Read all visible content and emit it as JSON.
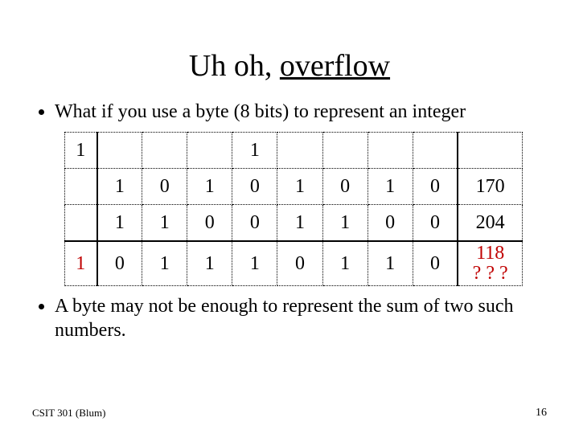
{
  "title": {
    "prefix": "Uh oh, ",
    "emph": "overflow"
  },
  "bullets": {
    "top": "What if you use a byte (8 bits) to represent an integer",
    "bottom": "A byte may not be enough to represent the sum of two such numbers."
  },
  "table": {
    "rows": [
      {
        "carry": "1",
        "bits": [
          "",
          "",
          "",
          "1",
          "",
          "",
          "",
          ""
        ],
        "value": ""
      },
      {
        "carry": "",
        "bits": [
          "1",
          "0",
          "1",
          "0",
          "1",
          "0",
          "1",
          "0"
        ],
        "value": "170"
      },
      {
        "carry": "",
        "bits": [
          "1",
          "1",
          "0",
          "0",
          "1",
          "1",
          "0",
          "0"
        ],
        "value": "204"
      },
      {
        "carry": "1",
        "bits": [
          "0",
          "1",
          "1",
          "1",
          "0",
          "1",
          "1",
          "0"
        ],
        "value": "118\n? ? ?",
        "carry_red": true,
        "value_red": true
      }
    ]
  },
  "footer": {
    "left": "CSIT 301 (Blum)",
    "right": "16"
  }
}
